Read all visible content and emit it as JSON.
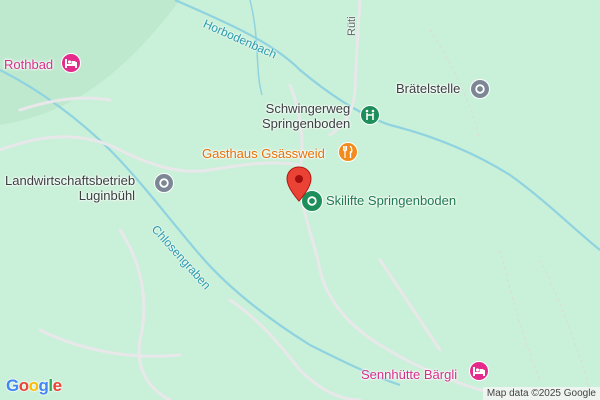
{
  "map": {
    "places": [
      {
        "id": "rothbad",
        "label": "Rothbad",
        "category": "hotel",
        "color": "#e42b8c"
      },
      {
        "id": "braetelstelle",
        "label": "Brätelstelle",
        "category": "landmark",
        "color": "#7b8794"
      },
      {
        "id": "schwingerweg",
        "label_line1": "Schwingerweg",
        "label_line2": "Springenboden",
        "category": "park",
        "color": "#1e8e5a"
      },
      {
        "id": "gasthaus",
        "label": "Gasthaus Gsässweid",
        "category": "restaurant",
        "color": "#f28b1d"
      },
      {
        "id": "landwirtschaft",
        "label_line1": "Landwirtschaftsbetrieb",
        "label_line2": "Luginbühl",
        "category": "landmark",
        "color": "#7b8794"
      },
      {
        "id": "skilifte",
        "label": "Skilifte Springenboden",
        "category": "ski",
        "color": "#1e8e5a"
      },
      {
        "id": "sennhuette",
        "label": "Sennhütte Bärgli",
        "category": "hotel",
        "color": "#e42b8c"
      }
    ],
    "water_labels": {
      "horbodenbach": "Horbodenbach",
      "chlosengraben": "Chlosengraben"
    },
    "road_labels": {
      "rueti": "Rüti"
    },
    "marker_color": "#ea4335",
    "attribution": "Map data ©2025 Google",
    "logo": {
      "letters": [
        "G",
        "o",
        "o",
        "g",
        "l",
        "e"
      ],
      "colors": [
        "#4285f4",
        "#ea4335",
        "#fbbc05",
        "#4285f4",
        "#34a853",
        "#ea4335"
      ]
    }
  }
}
